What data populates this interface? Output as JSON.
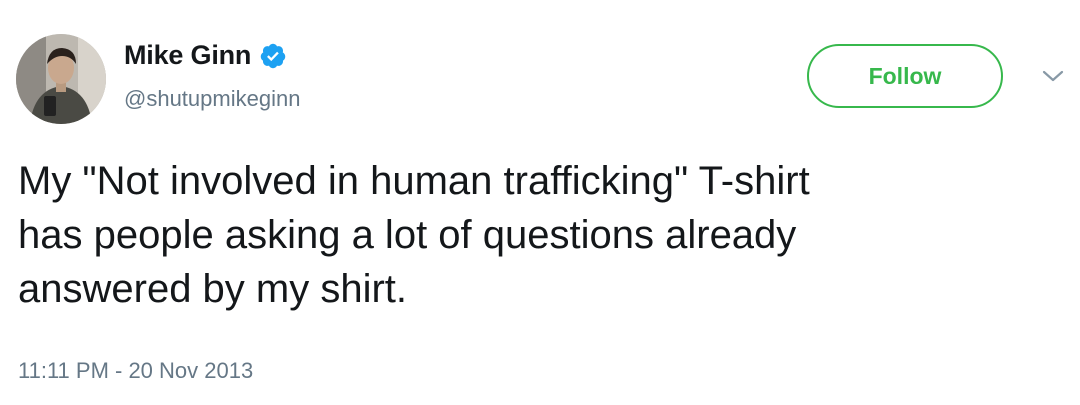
{
  "author": {
    "name": "Mike Ginn",
    "handle": "@shutupmikeginn",
    "verified": true,
    "verified_icon": "verified-badge-icon",
    "avatar": "profile-photo"
  },
  "follow_button": {
    "label": "Follow"
  },
  "menu": {
    "icon": "chevron-down-icon"
  },
  "tweet": {
    "lines": [
      "My \"Not involved in human trafficking\" T-shirt",
      "has people asking a lot of questions already",
      "answered by my shirt."
    ],
    "timestamp": "11:11 PM - 20 Nov 2013"
  },
  "colors": {
    "follow_green": "#37b84c",
    "verified_blue": "#1da1f2",
    "secondary_text": "#657786",
    "primary_text": "#14171a"
  }
}
